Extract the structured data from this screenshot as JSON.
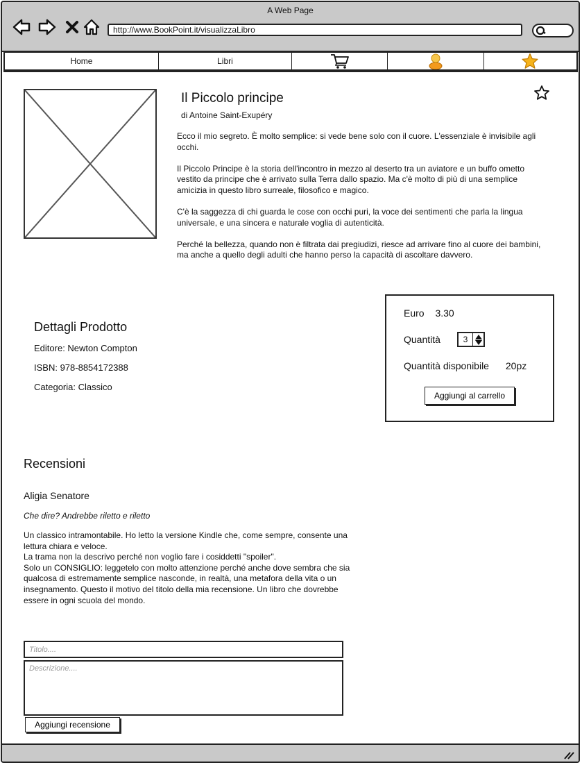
{
  "window": {
    "title": "A Web Page"
  },
  "browser": {
    "url": "http://www.BookPoint.it/visualizzaLibro"
  },
  "nav": {
    "tabs": [
      {
        "label": "Home"
      },
      {
        "label": "Libri"
      },
      {
        "icon": "cart-icon"
      },
      {
        "icon": "user-icon"
      },
      {
        "icon": "star-icon"
      }
    ]
  },
  "book": {
    "title": "Il Piccolo principe",
    "author": "di Antoine Saint-Exupéry",
    "description": [
      "Ecco il mio segreto. È molto semplice: si vede bene solo con il cuore. L'essenziale è invisibile agli occhi.",
      "Il Piccolo Principe è la storia dell'incontro in mezzo al deserto tra un aviatore e un buffo ometto vestito da principe che è arrivato sulla Terra dallo spazio. Ma c'è molto di più di una semplice amicizia in questo libro surreale, filosofico e magico.",
      "C'è la saggezza di chi guarda le cose con occhi puri, la voce dei sentimenti che parla la lingua universale, e una sincera e naturale voglia di autenticità.",
      "Perché la bellezza, quando non è filtrata dai pregiudizi, riesce ad arrivare fino al cuore dei bambini, ma anche a quello degli adulti che hanno perso la capacità di ascoltare davvero."
    ]
  },
  "details": {
    "heading": "Dettagli Prodotto",
    "publisher": "Editore: Newton Compton",
    "isbn": "ISBN: 978-8854172388",
    "category": "Categoria: Classico"
  },
  "purchase": {
    "price_label": "Euro",
    "price": "3.30",
    "quantity_label": "Quantità",
    "quantity": "3",
    "available_label": "Quantità disponibile",
    "available": "20pz",
    "add_to_cart": "Aggiungi al carrello"
  },
  "reviews": {
    "heading": "Recensioni",
    "items": [
      {
        "author": "Aligia Senatore",
        "title": "Che dire? Andrebbe riletto e riletto",
        "body": "Un classico intramontabile. Ho letto la versione Kindle che, come sempre, consente una lettura chiara e veloce.\nLa trama non la descrivo perché non voglio fare i cosiddetti \"spoiler\".\nSolo un CONSIGLIO: leggetelo con molto attenzione perché anche dove sembra che sia qualcosa di estremamente semplice nasconde, in realtà, una metafora della vita o un insegnamento. Questo il motivo del titolo della mia recensione. Un libro che dovrebbe essere in ogni scuola del mondo."
      }
    ],
    "form": {
      "title_placeholder": "Titolo....",
      "description_placeholder": "Descrizione....",
      "submit": "Aggiungi recensione"
    }
  }
}
